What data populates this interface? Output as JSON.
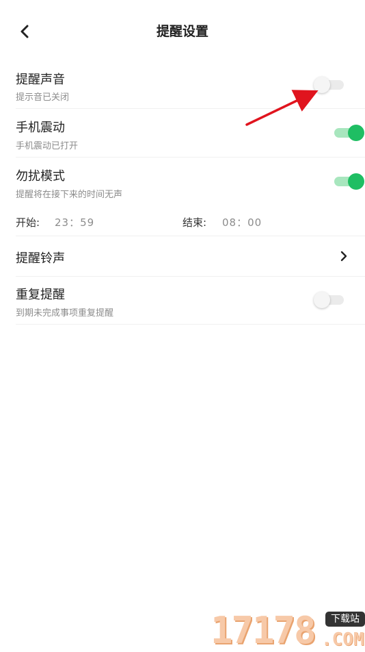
{
  "header": {
    "title": "提醒设置"
  },
  "settings": {
    "sound": {
      "title": "提醒声音",
      "subtitle": "提示音已关闭",
      "enabled": false
    },
    "vibrate": {
      "title": "手机震动",
      "subtitle": "手机震动已打开",
      "enabled": true
    },
    "dnd": {
      "title": "勿扰模式",
      "subtitle": "提醒将在接下来的时间无声",
      "enabled": true,
      "start_label": "开始:",
      "start_time": "23：59",
      "end_label": "结束:",
      "end_time": "08：00"
    },
    "ringtone": {
      "title": "提醒铃声"
    },
    "repeat": {
      "title": "重复提醒",
      "subtitle": "到期未完成事项重复提醒",
      "enabled": false
    }
  },
  "watermark": {
    "digits": "17178",
    "badge": "下载站",
    "com": ".COM"
  },
  "colors": {
    "toggle_on": "#1fbe63",
    "toggle_on_track": "#a8e6be",
    "toggle_off_track": "#ebebeb",
    "annotation_arrow": "#e0141e"
  }
}
